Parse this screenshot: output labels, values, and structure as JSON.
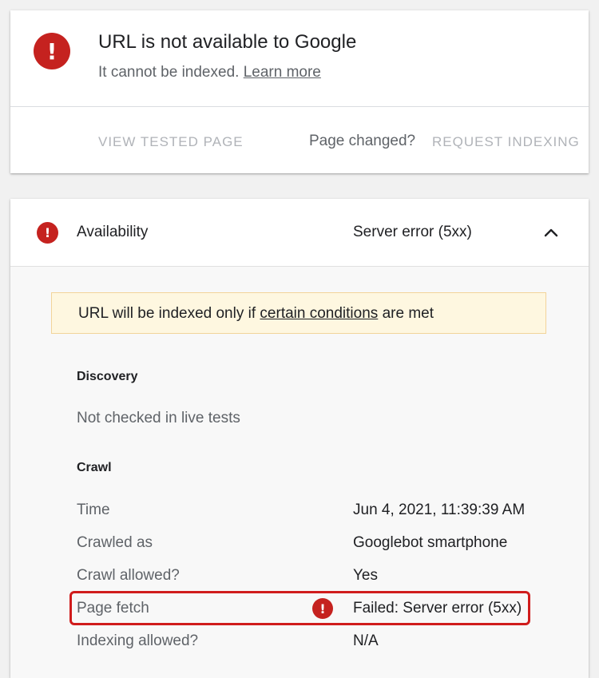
{
  "status": {
    "icon": "error-icon",
    "title": "URL is not available to Google",
    "subtitle": "It cannot be indexed.",
    "learn_more": "Learn more",
    "actions": {
      "view_tested_page": "VIEW TESTED PAGE",
      "page_changed": "Page changed?",
      "request_indexing": "REQUEST INDEXING"
    }
  },
  "availability": {
    "icon": "error-icon",
    "label": "Availability",
    "value": "Server error (5xx)",
    "toggle_icon": "chevron-up-icon",
    "notice": {
      "prefix": "URL will be indexed only if",
      "link": "certain conditions",
      "suffix": "are met"
    },
    "discovery": {
      "heading": "Discovery",
      "value": "Not checked in live tests"
    },
    "crawl": {
      "heading": "Crawl",
      "rows": [
        {
          "label": "Time",
          "value": "Jun 4, 2021, 11:39:39 AM"
        },
        {
          "label": "Crawled as",
          "value": "Googlebot smartphone"
        },
        {
          "label": "Crawl allowed?",
          "value": "Yes"
        },
        {
          "label": "Page fetch",
          "value": "Failed: Server error (5xx)",
          "status_icon": "error-icon"
        },
        {
          "label": "Indexing allowed?",
          "value": "N/A"
        }
      ]
    }
  },
  "colors": {
    "error": "#c5221f",
    "highlight": "#d01c1c",
    "notice_bg": "#fef7e0"
  }
}
